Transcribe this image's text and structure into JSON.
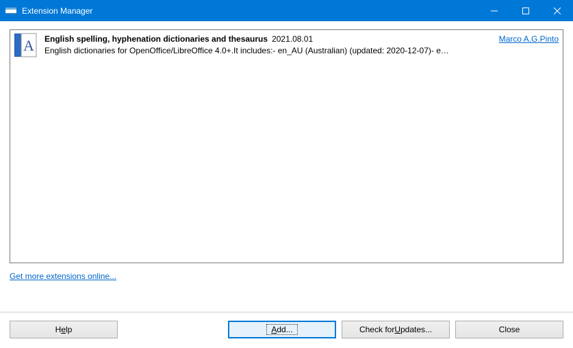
{
  "window": {
    "title": "Extension Manager"
  },
  "extension": {
    "name": "English spelling, hyphenation dictionaries and thesaurus",
    "version": "2021.08.01",
    "author": "Marco A.G.Pinto",
    "description": "English dictionaries for OpenOffice/LibreOffice 4.0+.It includes:- en_AU (Australian) (updated: 2020-12-07)- e…"
  },
  "links": {
    "moreextensions": "Get more extensions online..."
  },
  "buttons": {
    "help_pre": "H",
    "help_accel": "e",
    "help_post": "lp",
    "add_pre": "",
    "add_accel": "A",
    "add_post": "dd...",
    "updates_pre": "Check for ",
    "updates_accel": "U",
    "updates_post": "pdates...",
    "close": "Close"
  }
}
